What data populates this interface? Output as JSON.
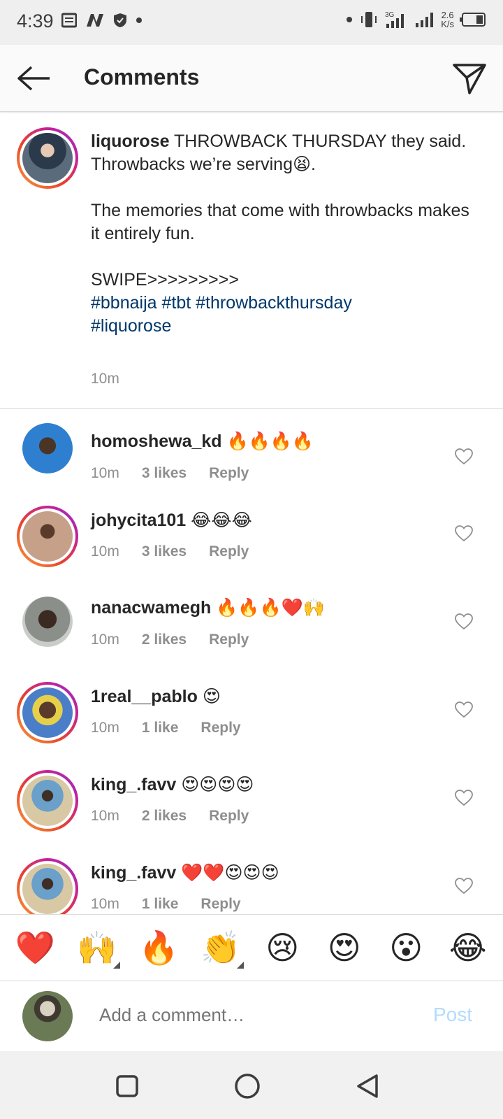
{
  "status_bar": {
    "time": "4:39",
    "network_speed_value": "2.6",
    "network_speed_unit": "K/s"
  },
  "header": {
    "title": "Comments",
    "back_icon": "arrow-left-icon",
    "send_icon": "paper-plane-icon"
  },
  "caption": {
    "username": "liquorose",
    "line1": " THROWBACK THURSDAY they said.",
    "line2": "Throwbacks we’re serving😫.",
    "line3": "The memories that come with throwbacks makes it entirely fun.",
    "line4": "SWIPE>>>>>>>>>",
    "hashtags_line1": "#bbnaija #tbt #throwbackthursday",
    "hashtags_line2": "#liquorose",
    "time": "10m"
  },
  "comments": [
    {
      "username": "homoshewa_kd",
      "text": "🔥🔥🔥🔥",
      "time": "10m",
      "likes": "3 likes",
      "reply": "Reply",
      "ring": false,
      "avatar_color": "#2f7fd0"
    },
    {
      "username": "johycita101",
      "text": "😂😂😂",
      "time": "10m",
      "likes": "3 likes",
      "reply": "Reply",
      "ring": true,
      "avatar_color": "#c7a08a"
    },
    {
      "username": "nanacwamegh",
      "text": "🔥🔥🔥❤️🙌",
      "time": "10m",
      "likes": "2 likes",
      "reply": "Reply",
      "ring": false,
      "avatar_color": "#6b6f6a"
    },
    {
      "username": "1real__pablo",
      "text": "😍",
      "time": "10m",
      "likes": "1 like",
      "reply": "Reply",
      "ring": true,
      "avatar_color": "#4a7ec9"
    },
    {
      "username": "king_.favv",
      "text": "😍😍😍😍",
      "time": "10m",
      "likes": "2 likes",
      "reply": "Reply",
      "ring": true,
      "avatar_color": "#d8c9a4"
    },
    {
      "username": "king_.favv",
      "text": "❤️❤️😍😍😍",
      "time": "10m",
      "likes": "1 like",
      "reply": "Reply",
      "ring": true,
      "avatar_color": "#d8c9a4"
    }
  ],
  "emoji_bar": [
    "❤️",
    "🙌",
    "🔥",
    "👏",
    "😢",
    "😍",
    "😮",
    "😂"
  ],
  "composer": {
    "placeholder": "Add a comment…",
    "post_label": "Post"
  },
  "colors": {
    "hashtag": "#00376b",
    "muted": "#8e8e8e",
    "post_disabled": "#b3dbff"
  }
}
